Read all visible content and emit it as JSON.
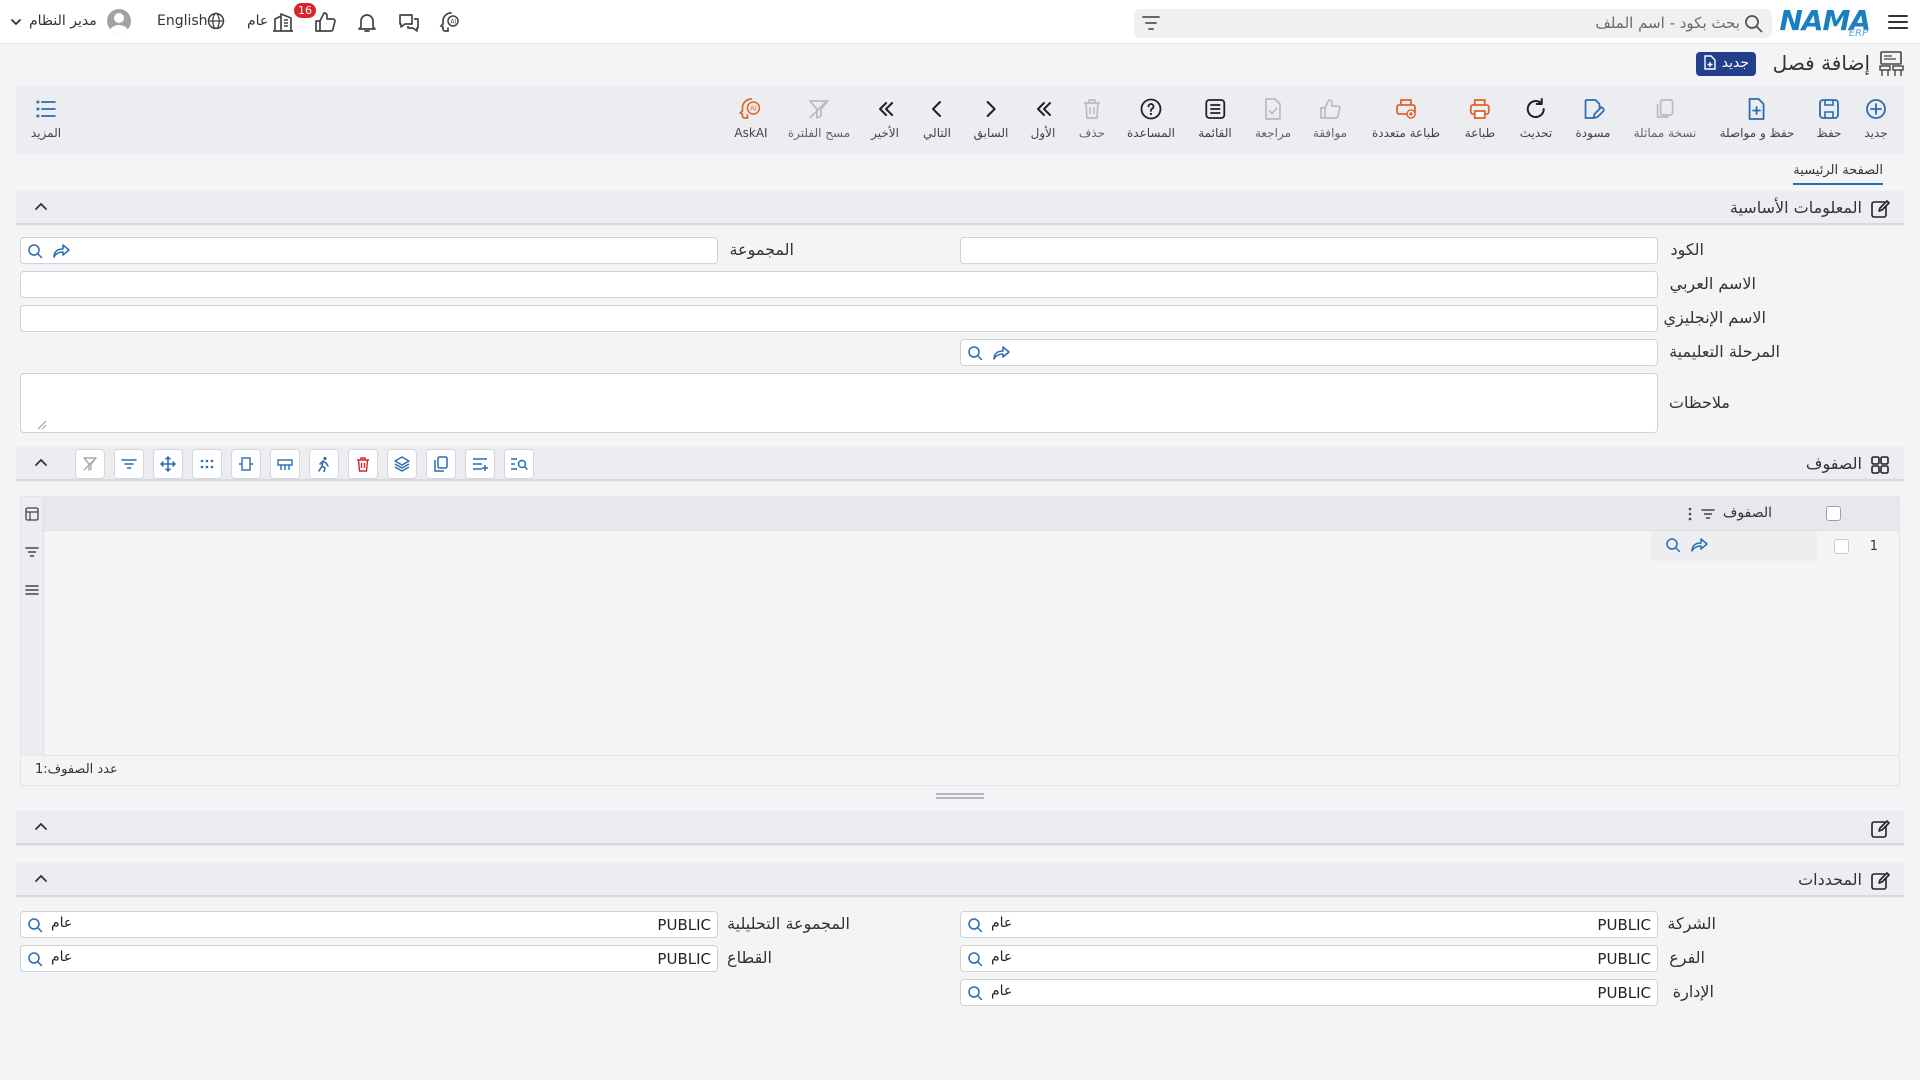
{
  "topbar": {
    "search_placeholder": "بحث بكود - اسم الملف",
    "notification_count": "16",
    "branch_label": "عام",
    "language": "English",
    "user_name": "مدير النظام"
  },
  "logo": {
    "text": "NAMA",
    "sub": "ERP"
  },
  "page": {
    "title": "إضافة فصل",
    "badge": "جديد"
  },
  "toolbar": {
    "buttons": [
      {
        "label": "جديد",
        "icon": "plus-circle-icon"
      },
      {
        "label": "حفظ",
        "icon": "save-icon"
      },
      {
        "label": "حفظ و مواصلة",
        "icon": "save-continue-icon"
      },
      {
        "label": "نسخة مماثلة",
        "icon": "copy-icon"
      },
      {
        "label": "مسودة",
        "icon": "draft-icon"
      },
      {
        "label": "تحديث",
        "icon": "refresh-icon"
      },
      {
        "label": "طباعة",
        "icon": "print-icon"
      },
      {
        "label": "طباعة متعددة",
        "icon": "multi-print-icon"
      },
      {
        "label": "موافقة",
        "icon": "thumbs-up-icon"
      },
      {
        "label": "مراجعة",
        "icon": "review-icon"
      },
      {
        "label": "القائمة",
        "icon": "list-icon"
      },
      {
        "label": "المساعدة",
        "icon": "help-icon"
      },
      {
        "label": "حذف",
        "icon": "trash-icon"
      },
      {
        "label": "الأول",
        "icon": "first-icon"
      },
      {
        "label": "السابق",
        "icon": "previous-icon"
      },
      {
        "label": "التالي",
        "icon": "next-icon"
      },
      {
        "label": "الأخير",
        "icon": "last-icon"
      },
      {
        "label": "مسح الفلترة",
        "icon": "clear-filter-icon"
      },
      {
        "label": "AskAI",
        "icon": "ai-icon"
      }
    ],
    "more_label": "المزيد"
  },
  "tabs": {
    "main": "الصفحة الرئيسية"
  },
  "basic_info": {
    "title": "المعلومات الأساسية",
    "code_label": "الكود",
    "group_label": "المجموعة",
    "arabic_name_label": "الاسم العربي",
    "english_name_label": "الاسم الإنجليزي",
    "stage_label": "المرحلة التعليمية",
    "notes_label": "ملاحظات"
  },
  "rows_section": {
    "title": "الصفوف",
    "column_header": "الصفوف",
    "row_number": "1",
    "count_label": "عدد الصفوف:",
    "count_value": "1"
  },
  "determinants": {
    "title": "المحددات",
    "company_label": "الشركة",
    "company_value": "PUBLIC",
    "company_chip": "عام",
    "branch_label": "الفرع",
    "branch_value": "PUBLIC",
    "branch_chip": "عام",
    "department_label": "الإدارة",
    "department_value": "PUBLIC",
    "department_chip": "عام",
    "analytic_label": "المجموعة التحليلية",
    "analytic_value": "PUBLIC",
    "analytic_chip": "عام",
    "sector_label": "القطاع",
    "sector_value": "PUBLIC",
    "sector_chip": "عام"
  },
  "colors": {
    "primary": "#2a6cb0",
    "accent_orange": "#e2632a",
    "badge_red": "#d9232d",
    "title_badge": "#233f8c"
  }
}
